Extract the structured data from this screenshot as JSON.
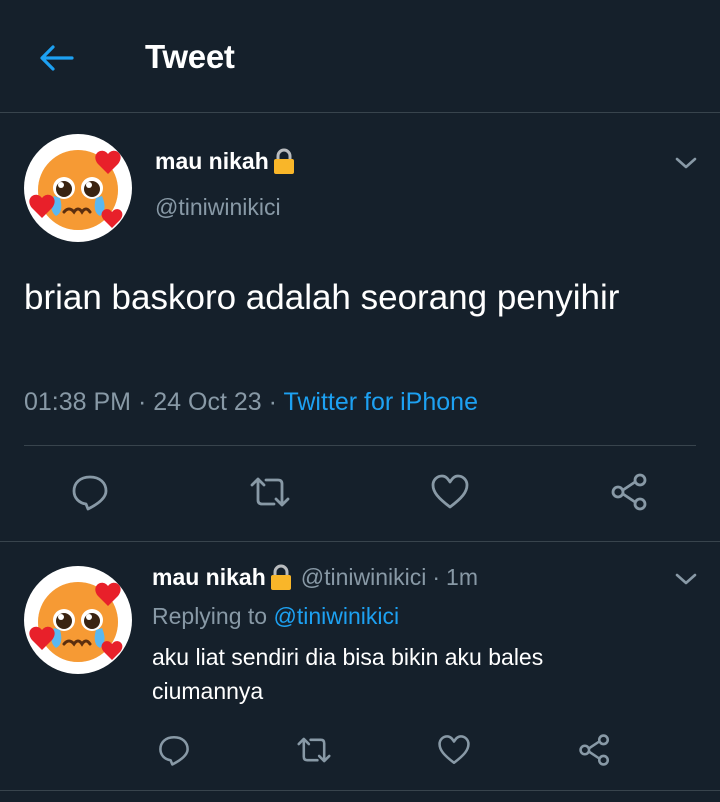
{
  "header": {
    "title": "Tweet",
    "back_icon": "arrow-left-icon"
  },
  "colors": {
    "background": "#15202b",
    "accent": "#1da1f2",
    "secondary_text": "#8899a6",
    "divider": "#38444d"
  },
  "tweet": {
    "author_name": "mau nikah",
    "author_handle": "@tiniwinikici",
    "text": "brian baskoro adalah seorang penyihir",
    "time": "01:38 PM",
    "sep1": "·",
    "date": "24 Oct 23",
    "sep2": "·",
    "source": "Twitter for iPhone"
  },
  "actions": [
    "reply-icon",
    "retweet-icon",
    "like-icon",
    "share-icon"
  ],
  "reply": {
    "author_name": "mau nikah",
    "author_handle": "@tiniwinikici",
    "sep": "·",
    "time_ago": "1m",
    "replying_label": "Replying to",
    "replying_to": "@tiniwinikici",
    "text": "aku liat sendiri dia bisa bikin aku bales ciumannya"
  }
}
